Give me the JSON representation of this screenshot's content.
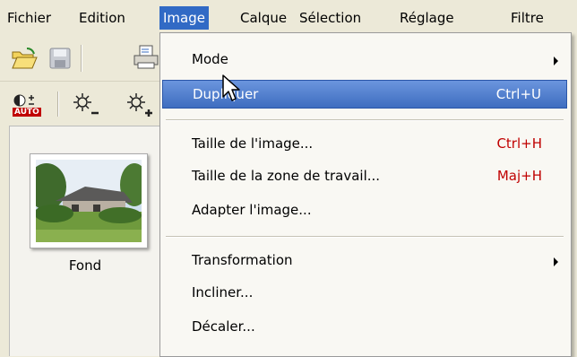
{
  "menubar": {
    "items": [
      {
        "label": "Fichier"
      },
      {
        "label": "Edition"
      },
      {
        "label": "Image"
      },
      {
        "label": "Calque"
      },
      {
        "label": "Sélection"
      },
      {
        "label": "Réglage"
      },
      {
        "label": "Filtre"
      }
    ],
    "active_color": "#316ac5"
  },
  "toolbar": {
    "auto_badge": "AUTO",
    "icons": [
      "open-folder-icon",
      "save-icon",
      "print-icon",
      "auto-exposure-icon",
      "brightness-minus-icon",
      "brightness-plus-icon"
    ]
  },
  "layers": {
    "items": [
      {
        "label": "Fond"
      }
    ]
  },
  "image_menu": {
    "highlight_color": "#3e6dc0",
    "shortcut_color": "#c00000",
    "items": [
      {
        "label": "Mode",
        "shortcut": "",
        "submenu": true
      },
      {
        "label": "Dupliquer",
        "shortcut": "Ctrl+U",
        "highlighted": true
      },
      {
        "label": "Taille de l'image...",
        "shortcut": "Ctrl+H"
      },
      {
        "label": "Taille de la zone de travail...",
        "shortcut": "Maj+H"
      },
      {
        "label": "Adapter l'image...",
        "shortcut": ""
      },
      {
        "label": "Transformation",
        "shortcut": "",
        "submenu": true
      },
      {
        "label": "Incliner...",
        "shortcut": ""
      },
      {
        "label": "Décaler...",
        "shortcut": ""
      }
    ]
  }
}
